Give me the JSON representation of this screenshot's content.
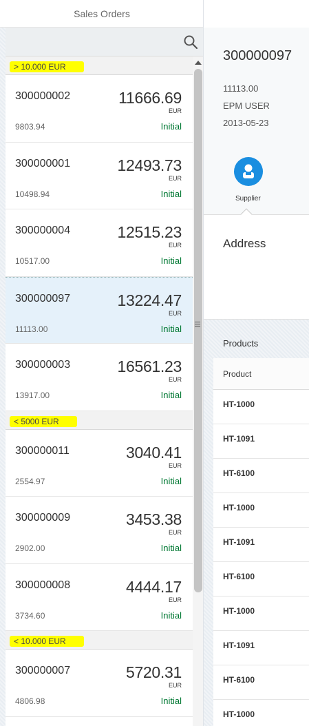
{
  "master": {
    "title": "Sales Orders",
    "groups": [
      {
        "label": "> 10.000 EUR",
        "items": [
          {
            "number": "300000002",
            "amount": "11666.69",
            "currency": "EUR",
            "net": "9803.94",
            "status": "Initial"
          },
          {
            "number": "300000001",
            "amount": "12493.73",
            "currency": "EUR",
            "net": "10498.94",
            "status": "Initial"
          },
          {
            "number": "300000004",
            "amount": "12515.23",
            "currency": "EUR",
            "net": "10517.00",
            "status": "Initial"
          },
          {
            "number": "300000097",
            "amount": "13224.47",
            "currency": "EUR",
            "net": "11113.00",
            "status": "Initial",
            "selected": true
          },
          {
            "number": "300000003",
            "amount": "16561.23",
            "currency": "EUR",
            "net": "13917.00",
            "status": "Initial"
          }
        ]
      },
      {
        "label": "< 5000 EUR",
        "items": [
          {
            "number": "300000011",
            "amount": "3040.41",
            "currency": "EUR",
            "net": "2554.97",
            "status": "Initial"
          },
          {
            "number": "300000009",
            "amount": "3453.38",
            "currency": "EUR",
            "net": "2902.00",
            "status": "Initial"
          },
          {
            "number": "300000008",
            "amount": "4444.17",
            "currency": "EUR",
            "net": "3734.60",
            "status": "Initial"
          }
        ]
      },
      {
        "label": "< 10.000 EUR",
        "items": [
          {
            "number": "300000007",
            "amount": "5720.31",
            "currency": "EUR",
            "net": "4806.98",
            "status": "Initial"
          }
        ]
      }
    ]
  },
  "detail": {
    "title": "300000097",
    "attributes": [
      "11113.00",
      "EPM USER",
      "2013-05-23"
    ],
    "tab": {
      "label": "Supplier",
      "icon": "supplier-icon"
    },
    "address_title": "Address",
    "products_title": "Products",
    "products_column": "Product",
    "products": [
      "HT-1000",
      "HT-1091",
      "HT-6100",
      "HT-1000",
      "HT-1091",
      "HT-6100",
      "HT-1000",
      "HT-1091",
      "HT-6100",
      "HT-1000"
    ]
  },
  "colors": {
    "highlight": "#ffff00",
    "status_green": "#007833",
    "accent": "#1a8ee0",
    "selected_row": "#e5f1fa"
  }
}
